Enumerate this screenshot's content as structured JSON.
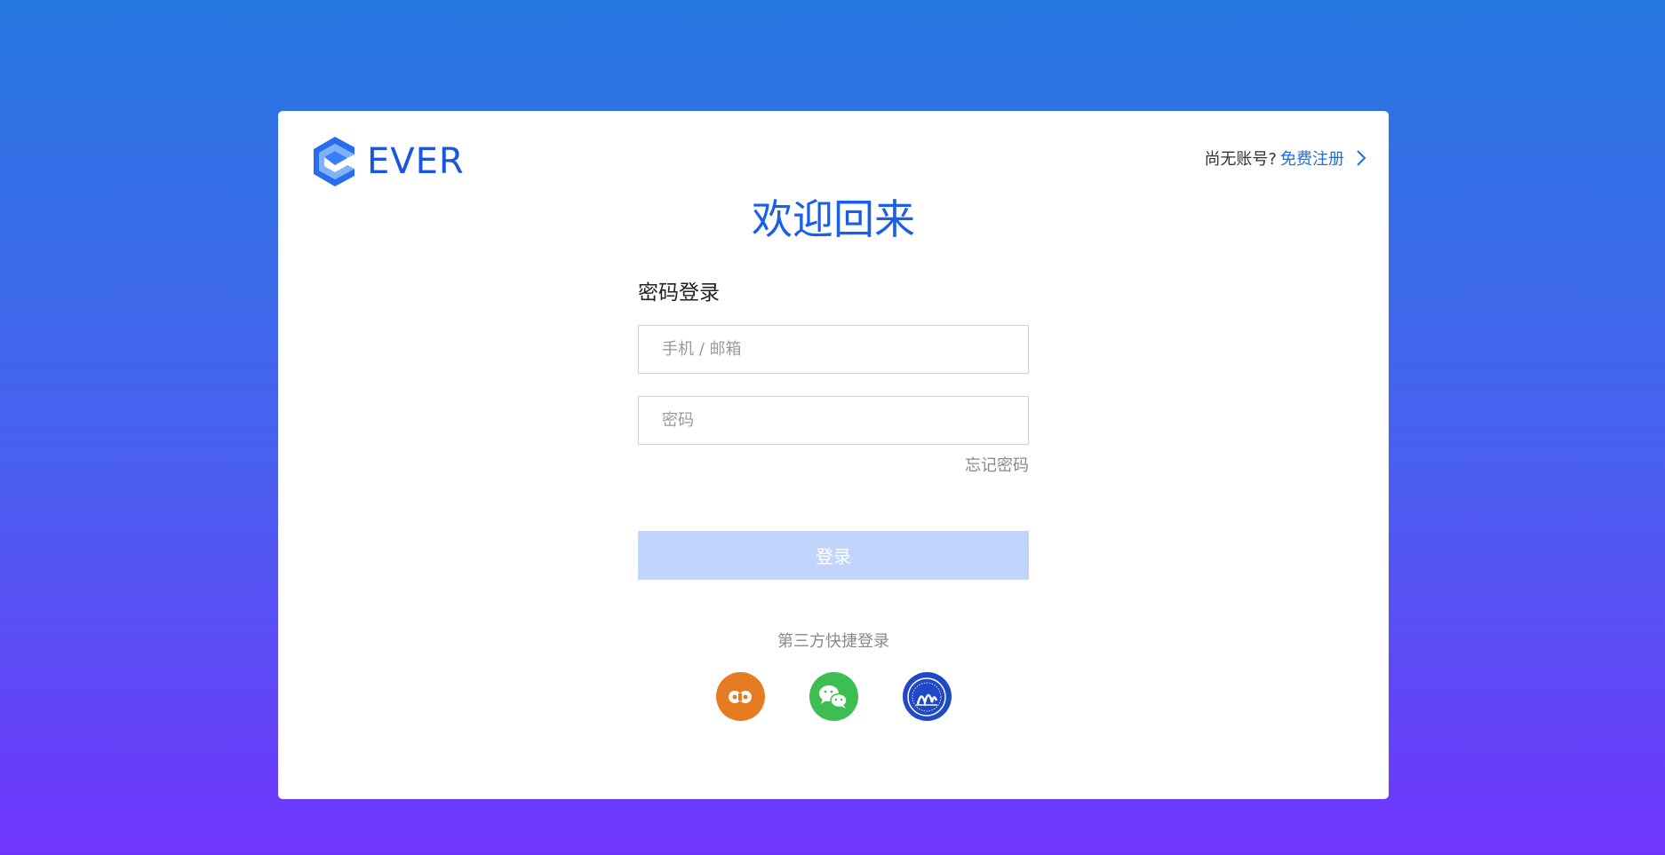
{
  "brand": {
    "name": "EVER",
    "color": "#1a55e0"
  },
  "header": {
    "no_account_text": "尚无账号?",
    "signup_link": "免费注册"
  },
  "welcome_title": "欢迎回来",
  "login_form": {
    "title": "密码登录",
    "account_placeholder": "手机 / 邮箱",
    "account_value": "",
    "password_placeholder": "密码",
    "password_value": "",
    "forgot_password": "忘记密码",
    "submit_label": "登录"
  },
  "third_party": {
    "label": "第三方快捷登录",
    "providers": [
      {
        "icon": "orange-cloud-icon",
        "color": "#e57c22"
      },
      {
        "icon": "wechat-icon",
        "color": "#3dbe52"
      },
      {
        "icon": "university-emblem-icon",
        "color": "#1f49c6"
      }
    ]
  },
  "colors": {
    "accent": "#1a5fe8",
    "button_disabled": "#c1d4fc",
    "background_top": "#2677e0",
    "background_bottom": "#7035fb"
  }
}
